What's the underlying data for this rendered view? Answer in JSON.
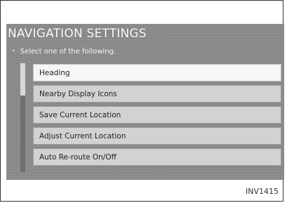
{
  "screen": {
    "title": "NAVIGATION SETTINGS",
    "instruction_bullet": "•",
    "instruction": "Select one of the following.",
    "menu": [
      {
        "label": "Heading",
        "selected": true
      },
      {
        "label": "Nearby Display Icons",
        "selected": false
      },
      {
        "label": "Save Current Location",
        "selected": false
      },
      {
        "label": "Adjust Current Location",
        "selected": false
      },
      {
        "label": "Auto Re-route On/Off",
        "selected": false
      }
    ]
  },
  "figure_id": "INV1415",
  "colors": {
    "screen_background": "#8a8a8a",
    "selected_item": "#f6f6f6",
    "menu_item": "#d2d2d2"
  }
}
